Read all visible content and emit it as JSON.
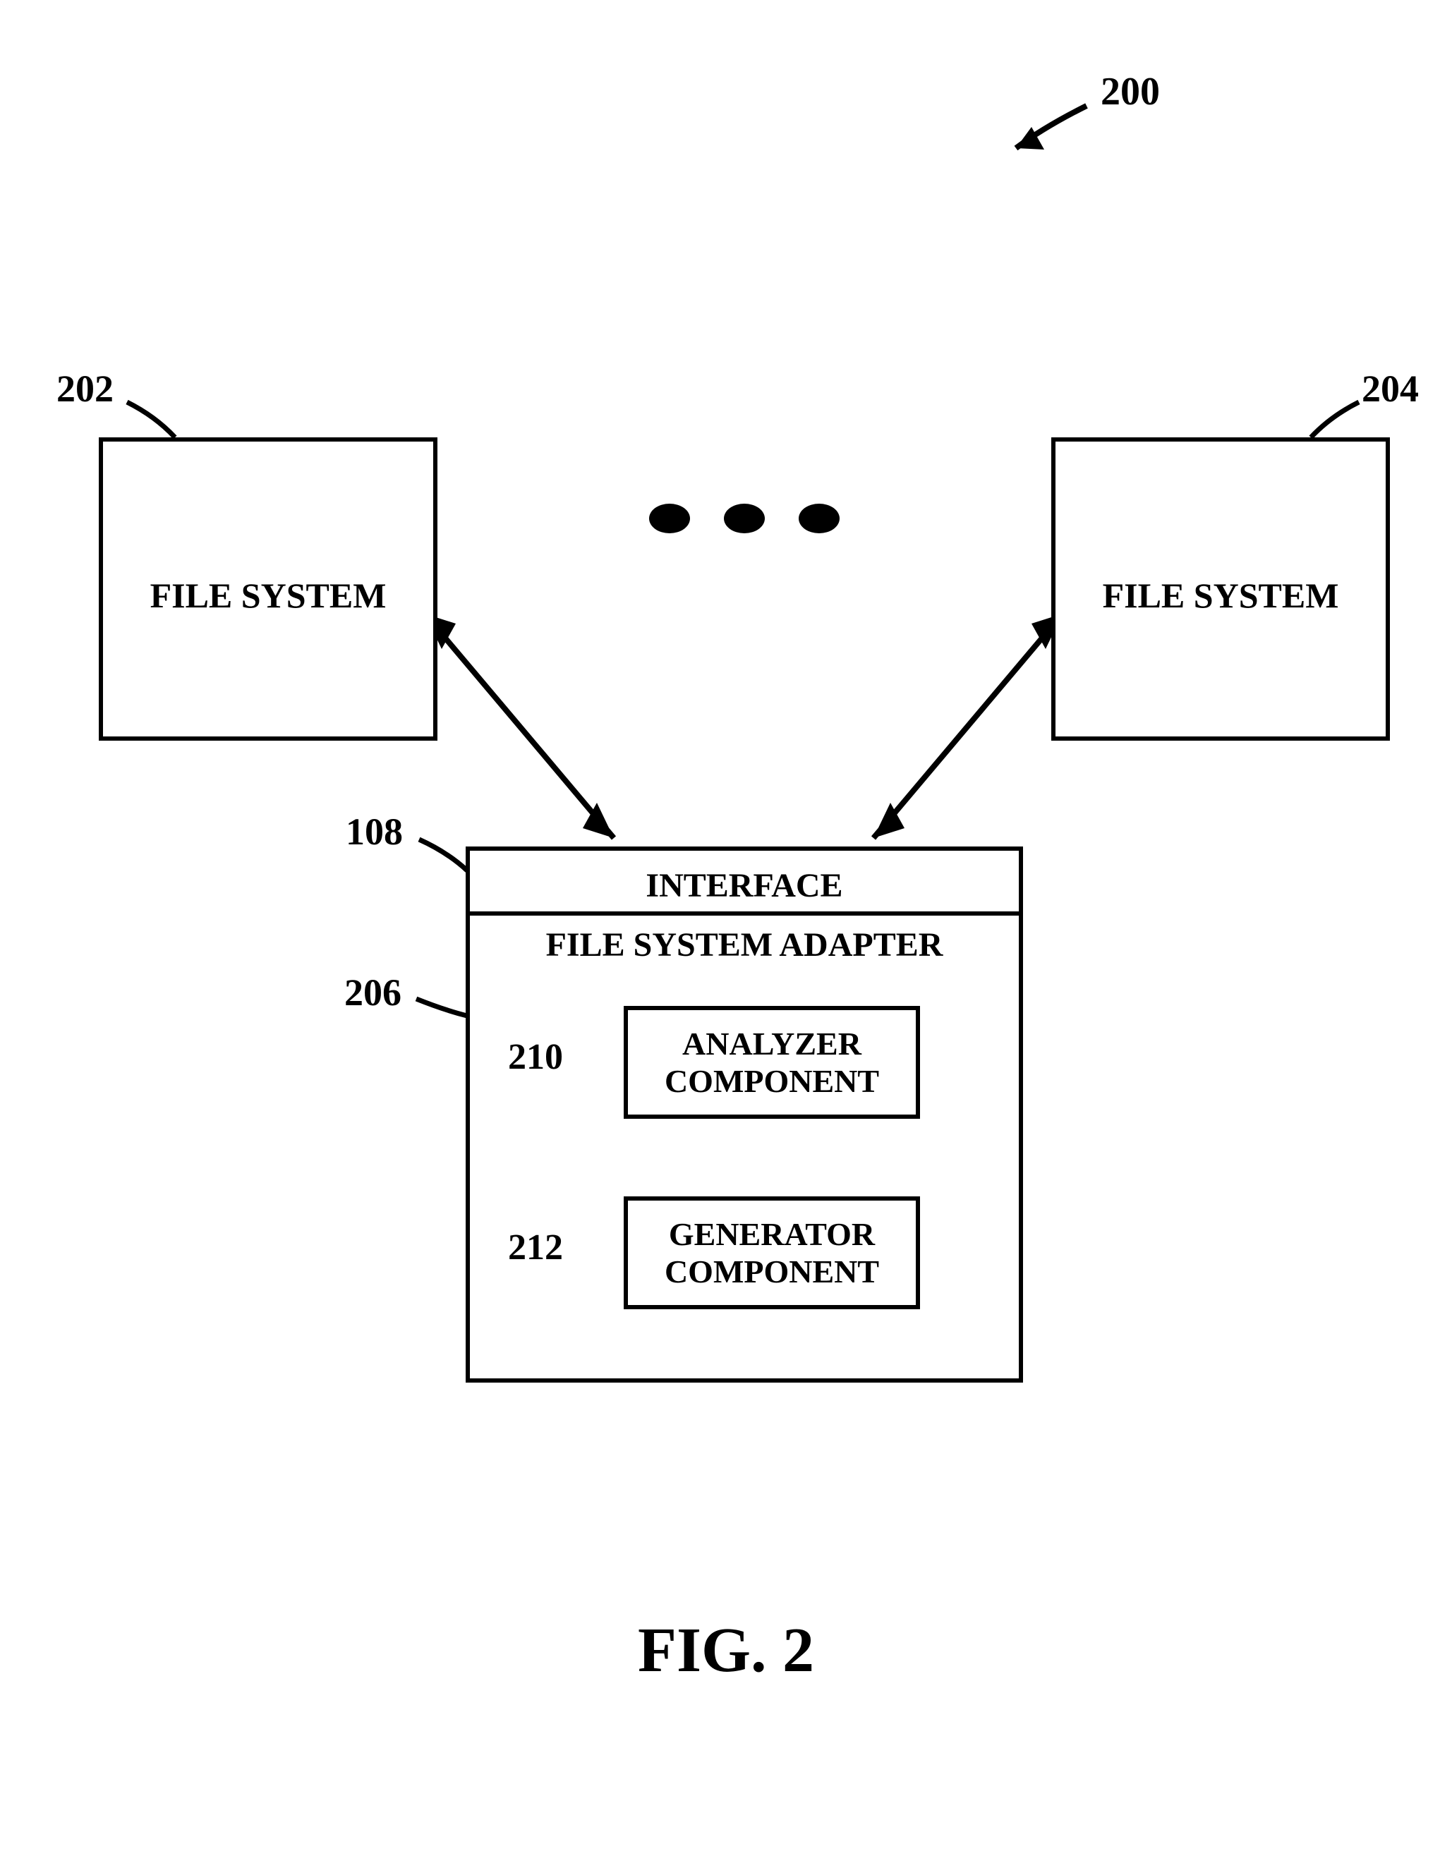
{
  "figureRef": "200",
  "labels": {
    "fs_left_ref": "202",
    "fs_right_ref": "204",
    "interface_ref": "108",
    "adapter_ref": "206",
    "analyzer_ref": "210",
    "generator_ref": "212"
  },
  "text": {
    "file_system_left": "FILE SYSTEM",
    "file_system_right": "FILE SYSTEM",
    "interface": "INTERFACE",
    "file_system_adapter": "FILE SYSTEM ADAPTER",
    "analyzer": "ANALYZER\nCOMPONENT",
    "generator": "GENERATOR\nCOMPONENT",
    "figure_caption": "FIG. 2"
  }
}
